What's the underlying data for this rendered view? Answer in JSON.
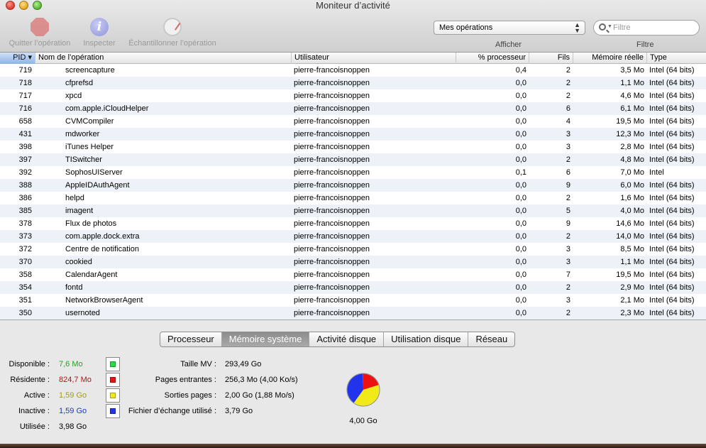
{
  "window": {
    "title": "Moniteur d’activité"
  },
  "toolbar": {
    "quit_label": "Quitter l’opération",
    "inspect_label": "Inspecter",
    "inspect_glyph": "i",
    "sample_label": "Échantillonner l’opération",
    "show_selected": "Mes opérations",
    "show_label": "Afficher",
    "filter_placeholder": "Filtre",
    "filter_label": "Filtre"
  },
  "table": {
    "columns": [
      "PID",
      "Nom de l’opération",
      "Utilisateur",
      "% processeur",
      "Fils",
      "Mémoire réelle",
      "Type"
    ],
    "sort_indicator": "▾",
    "rows": [
      {
        "pid": "719",
        "name": "screencapture",
        "user": "pierre-francoisnoppen",
        "cpu": "0,4",
        "threads": "2",
        "mem": "3,5 Mo",
        "type": "Intel (64 bits)"
      },
      {
        "pid": "718",
        "name": "cfprefsd",
        "user": "pierre-francoisnoppen",
        "cpu": "0,0",
        "threads": "2",
        "mem": "1,1 Mo",
        "type": "Intel (64 bits)"
      },
      {
        "pid": "717",
        "name": "xpcd",
        "user": "pierre-francoisnoppen",
        "cpu": "0,0",
        "threads": "2",
        "mem": "4,6 Mo",
        "type": "Intel (64 bits)"
      },
      {
        "pid": "716",
        "name": "com.apple.iCloudHelper",
        "user": "pierre-francoisnoppen",
        "cpu": "0,0",
        "threads": "6",
        "mem": "6,1 Mo",
        "type": "Intel (64 bits)"
      },
      {
        "pid": "658",
        "name": "CVMCompiler",
        "user": "pierre-francoisnoppen",
        "cpu": "0,0",
        "threads": "4",
        "mem": "19,5 Mo",
        "type": "Intel (64 bits)"
      },
      {
        "pid": "431",
        "name": "mdworker",
        "user": "pierre-francoisnoppen",
        "cpu": "0,0",
        "threads": "3",
        "mem": "12,3 Mo",
        "type": "Intel (64 bits)"
      },
      {
        "pid": "398",
        "name": "iTunes Helper",
        "user": "pierre-francoisnoppen",
        "cpu": "0,0",
        "threads": "3",
        "mem": "2,8 Mo",
        "type": "Intel (64 bits)"
      },
      {
        "pid": "397",
        "name": "TISwitcher",
        "user": "pierre-francoisnoppen",
        "cpu": "0,0",
        "threads": "2",
        "mem": "4,8 Mo",
        "type": "Intel (64 bits)"
      },
      {
        "pid": "392",
        "name": "SophosUIServer",
        "user": "pierre-francoisnoppen",
        "cpu": "0,1",
        "threads": "6",
        "mem": "7,0 Mo",
        "type": "Intel"
      },
      {
        "pid": "388",
        "name": "AppleIDAuthAgent",
        "user": "pierre-francoisnoppen",
        "cpu": "0,0",
        "threads": "9",
        "mem": "6,0 Mo",
        "type": "Intel (64 bits)"
      },
      {
        "pid": "386",
        "name": "helpd",
        "user": "pierre-francoisnoppen",
        "cpu": "0,0",
        "threads": "2",
        "mem": "1,6 Mo",
        "type": "Intel (64 bits)"
      },
      {
        "pid": "385",
        "name": "imagent",
        "user": "pierre-francoisnoppen",
        "cpu": "0,0",
        "threads": "5",
        "mem": "4,0 Mo",
        "type": "Intel (64 bits)"
      },
      {
        "pid": "378",
        "name": "Flux de photos",
        "user": "pierre-francoisnoppen",
        "cpu": "0,0",
        "threads": "9",
        "mem": "14,6 Mo",
        "type": "Intel (64 bits)"
      },
      {
        "pid": "373",
        "name": "com.apple.dock.extra",
        "user": "pierre-francoisnoppen",
        "cpu": "0,0",
        "threads": "2",
        "mem": "14,0 Mo",
        "type": "Intel (64 bits)"
      },
      {
        "pid": "372",
        "name": "Centre de notification",
        "user": "pierre-francoisnoppen",
        "cpu": "0,0",
        "threads": "3",
        "mem": "8,5 Mo",
        "type": "Intel (64 bits)"
      },
      {
        "pid": "370",
        "name": "cookied",
        "user": "pierre-francoisnoppen",
        "cpu": "0,0",
        "threads": "3",
        "mem": "1,1 Mo",
        "type": "Intel (64 bits)"
      },
      {
        "pid": "358",
        "name": "CalendarAgent",
        "user": "pierre-francoisnoppen",
        "cpu": "0,0",
        "threads": "7",
        "mem": "19,5 Mo",
        "type": "Intel (64 bits)"
      },
      {
        "pid": "354",
        "name": "fontd",
        "user": "pierre-francoisnoppen",
        "cpu": "0,0",
        "threads": "2",
        "mem": "2,9 Mo",
        "type": "Intel (64 bits)"
      },
      {
        "pid": "351",
        "name": "NetworkBrowserAgent",
        "user": "pierre-francoisnoppen",
        "cpu": "0,0",
        "threads": "3",
        "mem": "2,1 Mo",
        "type": "Intel (64 bits)"
      },
      {
        "pid": "350",
        "name": "usernoted",
        "user": "pierre-francoisnoppen",
        "cpu": "0,0",
        "threads": "2",
        "mem": "2,3 Mo",
        "type": "Intel (64 bits)"
      }
    ]
  },
  "tabs": [
    {
      "label": "Processeur",
      "active": false
    },
    {
      "label": "Mémoire système",
      "active": true
    },
    {
      "label": "Activité disque",
      "active": false
    },
    {
      "label": "Utilisation disque",
      "active": false
    },
    {
      "label": "Réseau",
      "active": false
    }
  ],
  "memory": {
    "free": {
      "label": "Disponible :",
      "value": "7,6 Mo",
      "color": "#1aa81a",
      "swatch": "#22dd44"
    },
    "wired": {
      "label": "Résidente :",
      "value": "824,7 Mo",
      "color": "#b01515",
      "swatch": "#ee1111"
    },
    "active": {
      "label": "Active :",
      "value": "1,59 Go",
      "color": "#a59a10",
      "swatch": "#f2ea18"
    },
    "inactive": {
      "label": "Inactive :",
      "value": "1,59 Go",
      "color": "#1a3cb0",
      "swatch": "#2233ee"
    },
    "used": {
      "label": "Utilisée :",
      "value": "3,98 Go"
    },
    "vm_size": {
      "label": "Taille MV :",
      "value": "293,49 Go"
    },
    "page_ins": {
      "label": "Pages entrantes :",
      "value": "256,3 Mo (4,00 Ko/s)"
    },
    "page_outs": {
      "label": "Sorties pages :",
      "value": "2,00 Go (1,88 Mo/s)"
    },
    "swap": {
      "label": "Fichier d’échange utilisé :",
      "value": "3,79 Go"
    },
    "total": "4,00 Go"
  }
}
